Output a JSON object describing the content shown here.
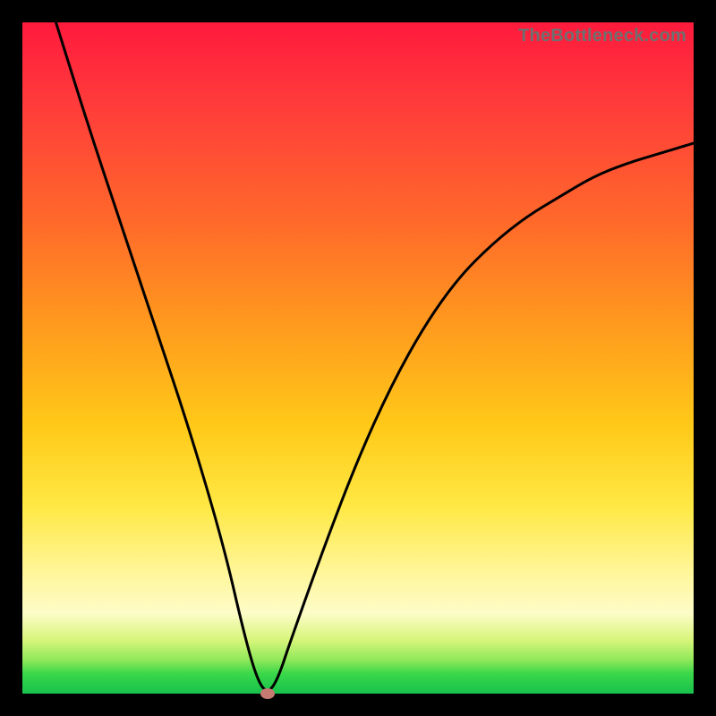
{
  "watermark": "TheBottleneck.com",
  "chart_data": {
    "type": "line",
    "title": "",
    "xlabel": "",
    "ylabel": "",
    "xlim": [
      0,
      100
    ],
    "ylim": [
      0,
      100
    ],
    "series": [
      {
        "name": "bottleneck-curve",
        "x": [
          5,
          10,
          15,
          20,
          25,
          30,
          33,
          35,
          36.5,
          38,
          40,
          45,
          50,
          55,
          60,
          65,
          70,
          75,
          80,
          85,
          90,
          95,
          100
        ],
        "values": [
          100,
          84,
          69,
          54,
          39,
          22,
          9,
          2,
          0,
          2,
          8,
          22,
          35,
          46,
          55,
          62,
          67,
          71,
          74,
          77,
          79,
          80.5,
          82
        ]
      }
    ],
    "marker": {
      "x": 36.5,
      "y": 0,
      "color": "#c67a72"
    },
    "gradient_stops": [
      {
        "pos": 0,
        "color": "#ff1a3c"
      },
      {
        "pos": 12,
        "color": "#ff3b3b"
      },
      {
        "pos": 30,
        "color": "#ff6a2a"
      },
      {
        "pos": 45,
        "color": "#ff9a1e"
      },
      {
        "pos": 60,
        "color": "#ffc918"
      },
      {
        "pos": 72,
        "color": "#ffe843"
      },
      {
        "pos": 82,
        "color": "#fff69a"
      },
      {
        "pos": 88,
        "color": "#fdfcc8"
      },
      {
        "pos": 92,
        "color": "#d7f57a"
      },
      {
        "pos": 95,
        "color": "#8fe85a"
      },
      {
        "pos": 97,
        "color": "#3bd84a"
      },
      {
        "pos": 100,
        "color": "#17c24c"
      }
    ]
  }
}
